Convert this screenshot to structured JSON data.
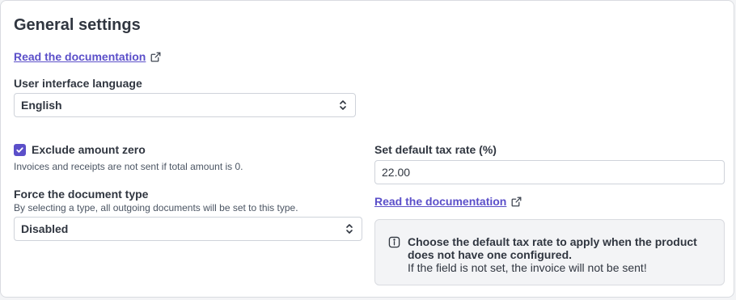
{
  "page": {
    "title": "General settings",
    "doc_link_label": "Read the documentation"
  },
  "language": {
    "label": "User interface language",
    "selected": "English"
  },
  "exclude_zero": {
    "label": "Exclude amount zero",
    "checked": true,
    "help": "Invoices and receipts are not sent if total amount is 0."
  },
  "document_type": {
    "label": "Force the document type",
    "help": "By selecting a type, all outgoing documents will be set to this type.",
    "selected": "Disabled"
  },
  "tax_rate": {
    "label": "Set default tax rate (%)",
    "value": "22.00",
    "doc_link_label": "Read the documentation",
    "notice_title": "Choose the default tax rate to apply when the product does not have one configured.",
    "notice_body": "If the field is not set, the invoice will not be sent!"
  },
  "colors": {
    "accent": "#5b4fc9",
    "text": "#303640",
    "border": "#cfd3da",
    "notice_bg": "#f3f4f6"
  },
  "icons": {
    "external_link": "external-link-icon",
    "select_chevrons": "chevron-up-down-icon",
    "check": "check-icon",
    "info": "info-icon"
  }
}
